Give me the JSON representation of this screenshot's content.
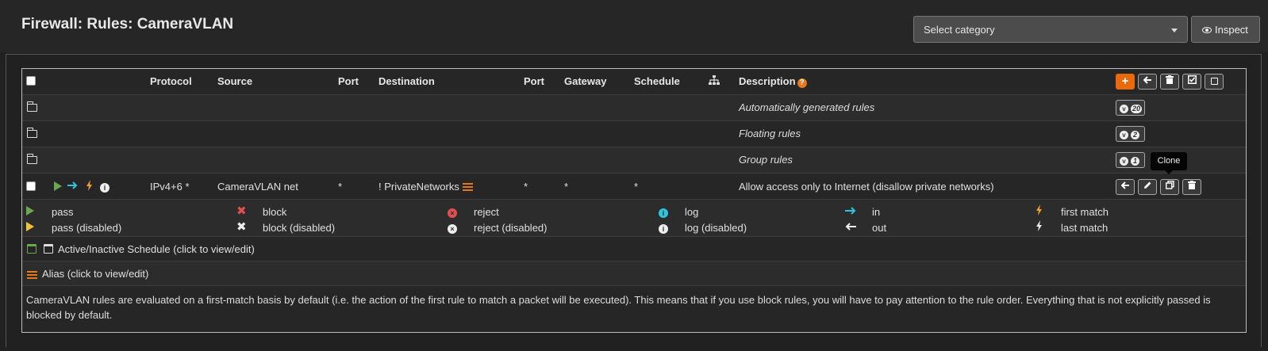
{
  "page": {
    "title": "Firewall: Rules: CameraVLAN"
  },
  "toolbar": {
    "category_placeholder": "Select category",
    "inspect_label": "Inspect"
  },
  "table": {
    "headers": {
      "protocol": "Protocol",
      "source": "Source",
      "port1": "Port",
      "destination": "Destination",
      "port2": "Port",
      "gateway": "Gateway",
      "schedule": "Schedule",
      "description": "Description"
    },
    "help_icon": "?",
    "add_icon": "+",
    "groups": [
      {
        "label": "Automatically generated rules",
        "count": "20"
      },
      {
        "label": "Floating rules",
        "count": "2"
      },
      {
        "label": "Group rules",
        "count": "1"
      }
    ],
    "rule": {
      "protocol": "IPv4+6 *",
      "source": "CameraVLAN net",
      "source_port": "*",
      "destination": "! PrivateNetworks",
      "dest_port": "*",
      "gateway": "*",
      "schedule": "*",
      "description": "Allow access only to Internet (disallow private networks)"
    },
    "tooltip": "Clone"
  },
  "legend": {
    "pass": "pass",
    "pass_disabled": "pass (disabled)",
    "block": "block",
    "block_disabled": "block (disabled)",
    "reject": "reject",
    "reject_disabled": "reject (disabled)",
    "log": "log",
    "log_disabled": "log (disabled)",
    "in": "in",
    "out": "out",
    "first_match": "first match",
    "last_match": "last match",
    "schedule_note": "Active/Inactive Schedule (click to view/edit)",
    "alias_note": "Alias (click to view/edit)",
    "footer": "CameraVLAN rules are evaluated on a first-match basis by default (i.e. the action of the first rule to match a packet will be executed). This means that if you use block rules, you will have to pay attention to the rule order. Everything that is not explicitly passed is blocked by default."
  },
  "colors": {
    "accent": "#e86a0c",
    "pass": "#6aa84f",
    "block": "#e05050",
    "log": "#2ec4e0"
  },
  "icons": [
    "eye-icon",
    "folder-icon",
    "play-icon",
    "arrow-right-icon",
    "lightning-icon",
    "info-icon",
    "sitemap-icon",
    "calendar-icon",
    "list-icon",
    "trash-icon",
    "pencil-icon",
    "clone-icon"
  ]
}
